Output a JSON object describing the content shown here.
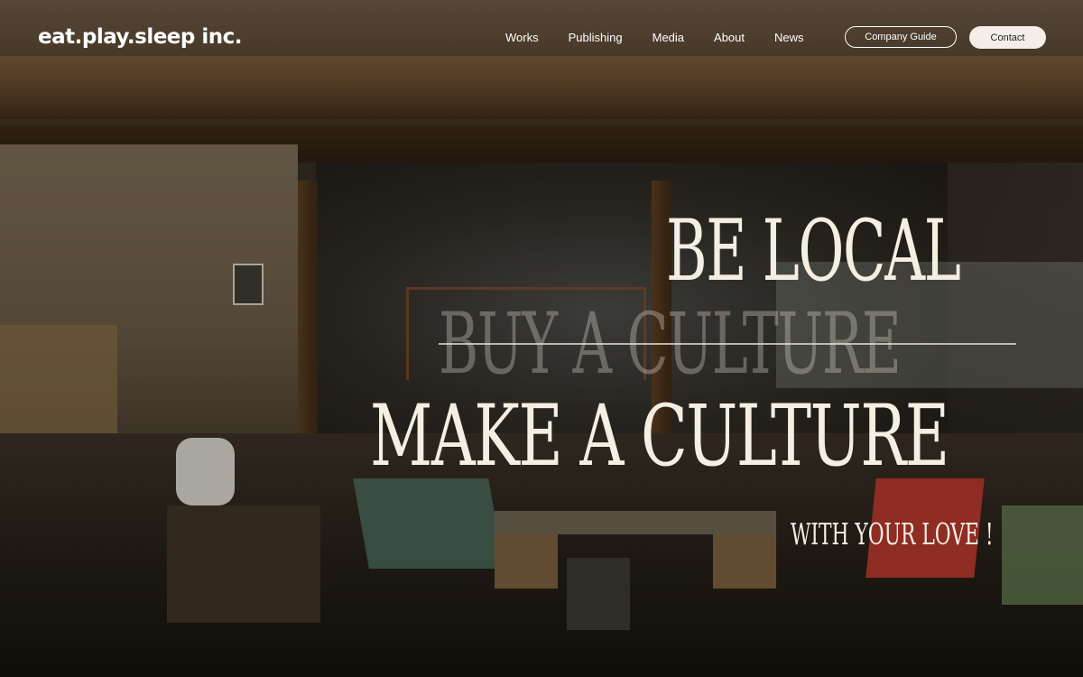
{
  "header": {
    "logo": "eat.play.sleep inc.",
    "nav": [
      {
        "label": "Works"
      },
      {
        "label": "Publishing"
      },
      {
        "label": "Media"
      },
      {
        "label": "About"
      },
      {
        "label": "News"
      }
    ],
    "company_guide_label": "Company Guide",
    "contact_label": "Contact"
  },
  "hero": {
    "line1": "BE LOCAL",
    "line2_struck": "BUY A CULTURE",
    "line3": "MAKE A CULTURE",
    "line4": "WITH YOUR LOVE !"
  },
  "colors": {
    "headline": "#f4eee3",
    "contact_bg": "#f3efe8",
    "nav_text": "#ffffff"
  }
}
